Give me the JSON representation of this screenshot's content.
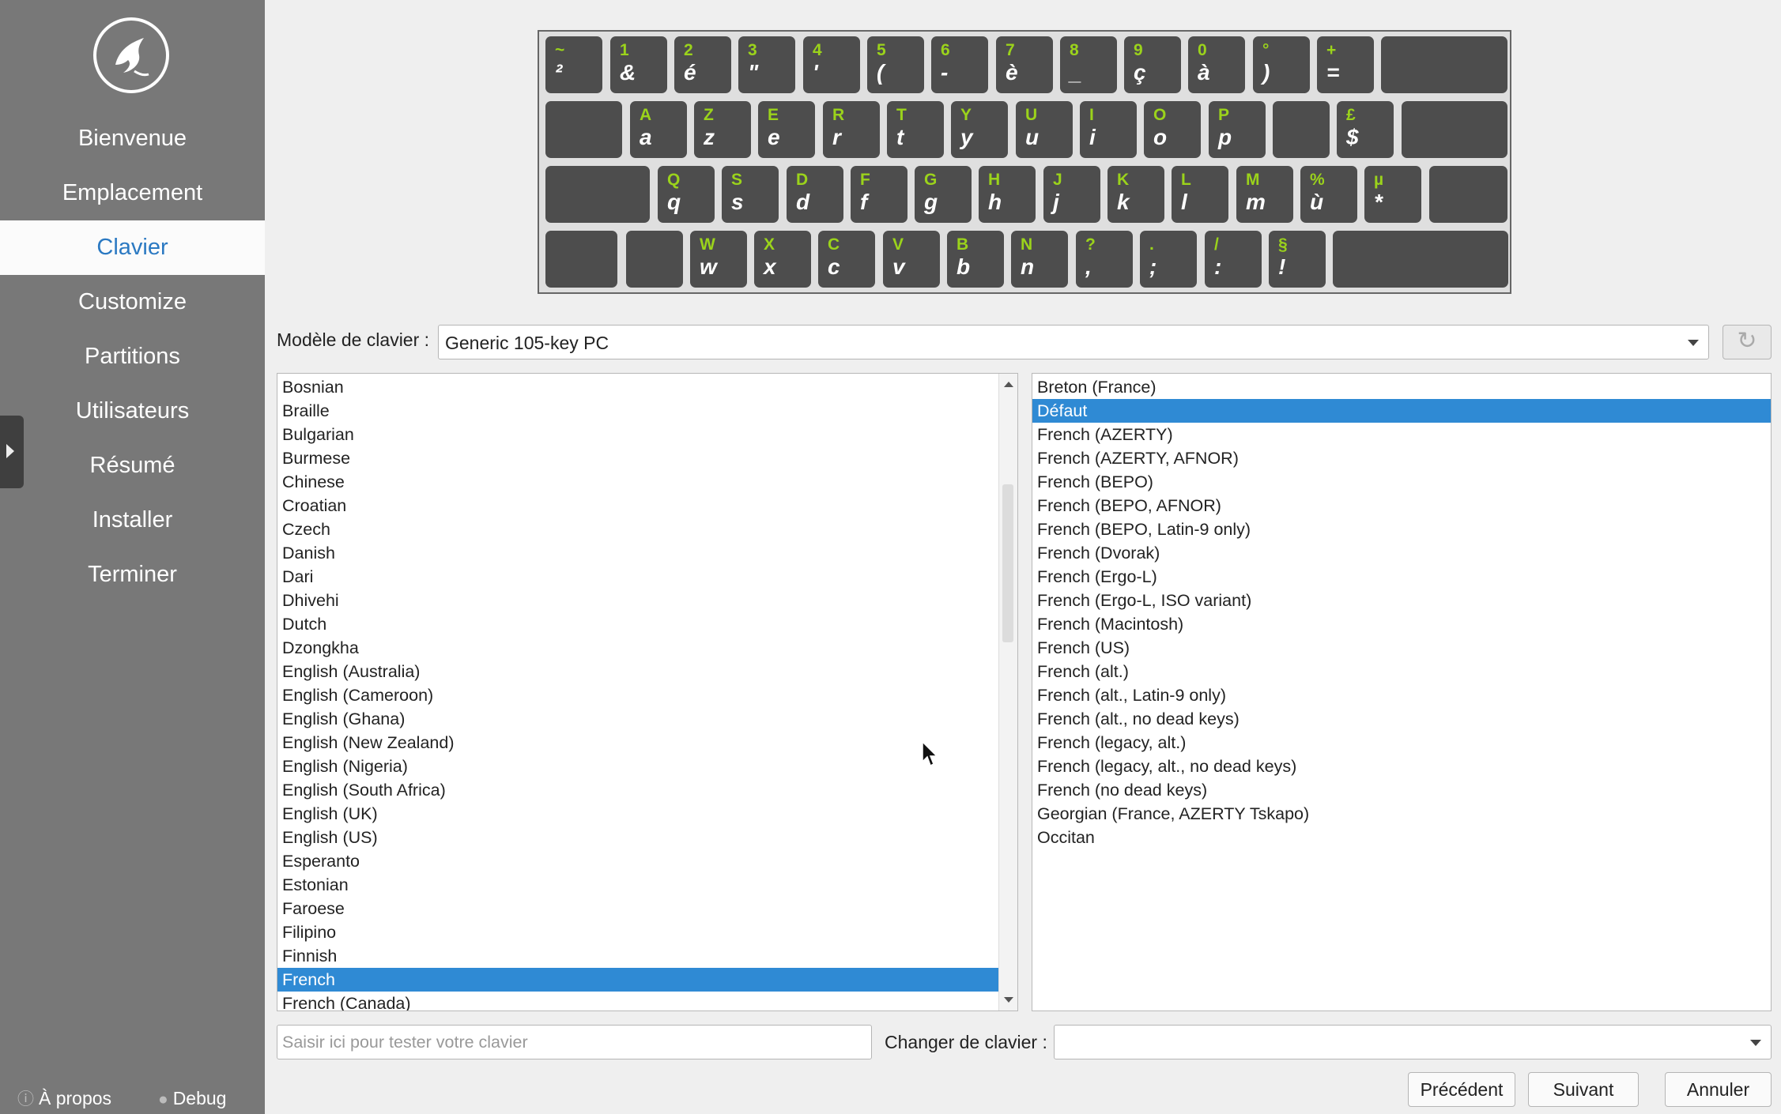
{
  "sidebar": {
    "items": [
      {
        "label": "Bienvenue"
      },
      {
        "label": "Emplacement"
      },
      {
        "label": "Clavier",
        "active": true
      },
      {
        "label": "Customize"
      },
      {
        "label": "Partitions"
      },
      {
        "label": "Utilisateurs"
      },
      {
        "label": "Résumé"
      },
      {
        "label": "Installer"
      },
      {
        "label": "Terminer"
      }
    ],
    "about_label": "À propos",
    "debug_label": "Debug"
  },
  "keyboard": {
    "rows": [
      [
        [
          "~",
          "²"
        ],
        [
          "1",
          "&"
        ],
        [
          "2",
          "é"
        ],
        [
          "3",
          "\""
        ],
        [
          "4",
          "'"
        ],
        [
          "5",
          "("
        ],
        [
          "6",
          "-"
        ],
        [
          "7",
          "è"
        ],
        [
          "8",
          "_"
        ],
        [
          "9",
          "ç"
        ],
        [
          "0",
          "à"
        ],
        [
          "°",
          ")"
        ],
        [
          "+",
          "="
        ],
        [
          "",
          ""
        ]
      ],
      [
        [
          "",
          ""
        ],
        [
          "A",
          "a"
        ],
        [
          "Z",
          "z"
        ],
        [
          "E",
          "e"
        ],
        [
          "R",
          "r"
        ],
        [
          "T",
          "t"
        ],
        [
          "Y",
          "y"
        ],
        [
          "U",
          "u"
        ],
        [
          "I",
          "i"
        ],
        [
          "O",
          "o"
        ],
        [
          "P",
          "p"
        ],
        [
          "",
          ""
        ],
        [
          "£",
          "$"
        ],
        [
          "",
          ""
        ]
      ],
      [
        [
          "",
          ""
        ],
        [
          "Q",
          "q"
        ],
        [
          "S",
          "s"
        ],
        [
          "D",
          "d"
        ],
        [
          "F",
          "f"
        ],
        [
          "G",
          "g"
        ],
        [
          "H",
          "h"
        ],
        [
          "J",
          "j"
        ],
        [
          "K",
          "k"
        ],
        [
          "L",
          "l"
        ],
        [
          "M",
          "m"
        ],
        [
          "%",
          "ù"
        ],
        [
          "µ",
          "*"
        ],
        [
          "",
          ""
        ]
      ],
      [
        [
          "",
          ""
        ],
        [
          "",
          ""
        ],
        [
          "W",
          "w"
        ],
        [
          "X",
          "x"
        ],
        [
          "C",
          "c"
        ],
        [
          "V",
          "v"
        ],
        [
          "B",
          "b"
        ],
        [
          "N",
          "n"
        ],
        [
          "?",
          ","
        ],
        [
          ".",
          ";"
        ],
        [
          "/",
          ":"
        ],
        [
          "§",
          "!"
        ],
        [
          "",
          ""
        ]
      ]
    ]
  },
  "model": {
    "label": "Modèle de clavier :",
    "value": "Generic 105-key PC"
  },
  "layouts": [
    "Bosnian",
    "Braille",
    "Bulgarian",
    "Burmese",
    "Chinese",
    "Croatian",
    "Czech",
    "Danish",
    "Dari",
    "Dhivehi",
    "Dutch",
    "Dzongkha",
    "English (Australia)",
    "English (Cameroon)",
    "English (Ghana)",
    "English (New Zealand)",
    "English (Nigeria)",
    "English (South Africa)",
    "English (UK)",
    "English (US)",
    "Esperanto",
    "Estonian",
    "Faroese",
    "Filipino",
    "Finnish",
    "French",
    "French (Canada)"
  ],
  "layout_selected": "French",
  "variants": [
    "Breton (France)",
    "Défaut",
    "French (AZERTY)",
    "French (AZERTY, AFNOR)",
    "French (BEPO)",
    "French (BEPO, AFNOR)",
    "French (BEPO, Latin-9 only)",
    "French (Dvorak)",
    "French (Ergo-L)",
    "French (Ergo-L, ISO variant)",
    "French (Macintosh)",
    "French (US)",
    "French (alt.)",
    "French (alt., Latin-9 only)",
    "French (alt., no dead keys)",
    "French (legacy, alt.)",
    "French (legacy, alt., no dead keys)",
    "French (no dead keys)",
    "Georgian (France, AZERTY Tskapo)",
    "Occitan"
  ],
  "variant_selected": "Défaut",
  "test": {
    "placeholder": "Saisir ici pour tester votre clavier"
  },
  "switch": {
    "label": "Changer de clavier :",
    "value": ""
  },
  "buttons": {
    "back": "Précédent",
    "next": "Suivant",
    "cancel": "Annuler"
  },
  "colors": {
    "accent": "#2f8ad4",
    "sidebar": "#787878",
    "key": "#4d4d4d",
    "key_legend": "#9bd31b"
  }
}
